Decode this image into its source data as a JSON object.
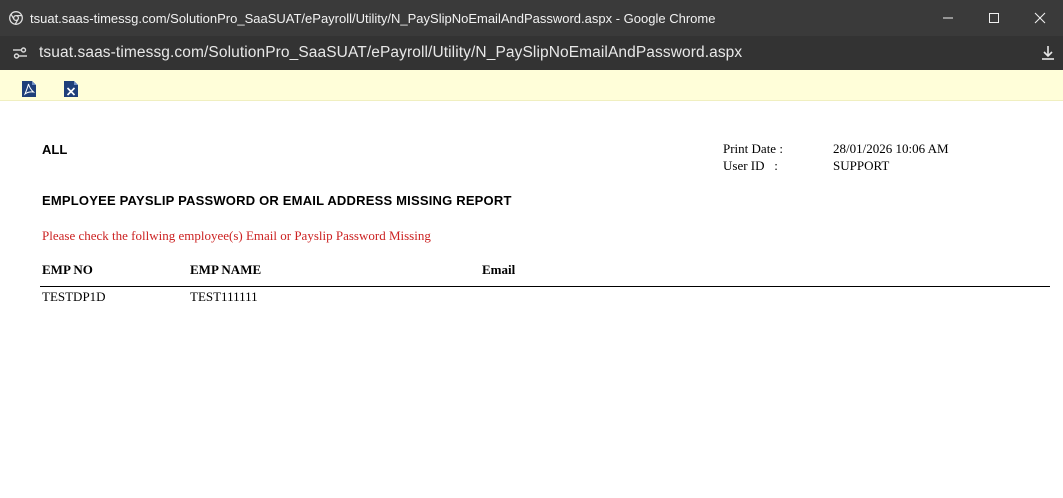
{
  "window": {
    "title": "tsuat.saas-timessg.com/SolutionPro_SaaSUAT/ePayroll/Utility/N_PaySlipNoEmailAndPassword.aspx - Google Chrome",
    "url": "tsuat.saas-timessg.com/SolutionPro_SaaSUAT/ePayroll/Utility/N_PaySlipNoEmailAndPassword.aspx"
  },
  "icons": {
    "app": "chrome-icon",
    "site_info": "site-info-icon",
    "download": "download-icon",
    "export_pdf": "pdf-icon",
    "export_excel": "excel-icon"
  },
  "report": {
    "scope": "ALL",
    "print_date_label": "Print Date :",
    "print_date_value": "28/01/2026 10:06 AM",
    "user_id_label": "User ID   :",
    "user_id_value": "SUPPORT",
    "title": "EMPLOYEE PAYSLIP PASSWORD OR EMAIL ADDRESS MISSING REPORT",
    "notice": "Please check the follwing employee(s) Email or Payslip Password Missing",
    "columns": [
      "EMP NO",
      "EMP NAME",
      "Email"
    ],
    "rows": [
      [
        "TESTDP1D",
        "TEST111111",
        ""
      ]
    ]
  },
  "colors": {
    "titlebar": "#3a3a3a",
    "addressbar": "#333333",
    "toolbar": "#fffed9",
    "notice": "#cc2222"
  }
}
